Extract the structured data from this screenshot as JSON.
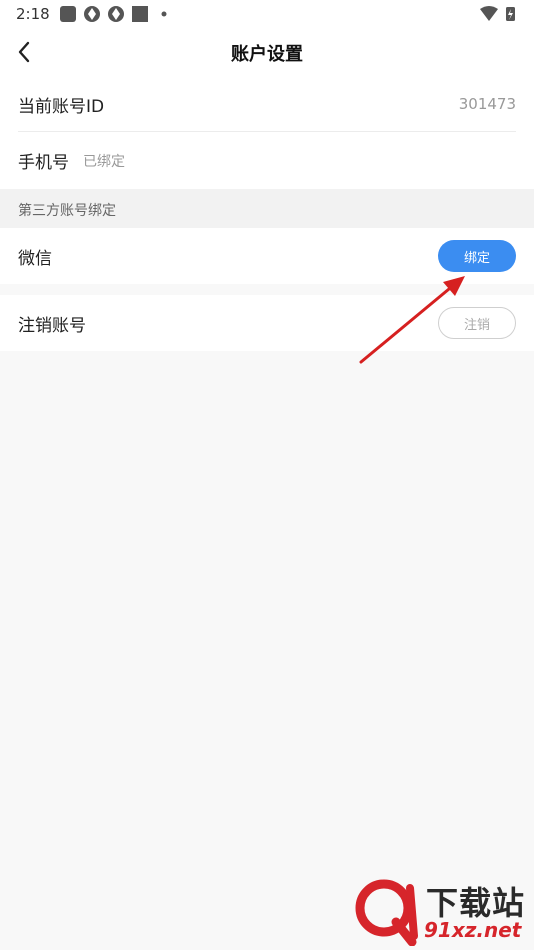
{
  "status_bar": {
    "time": "2:18"
  },
  "nav": {
    "title": "账户设置"
  },
  "account": {
    "id_label": "当前账号ID",
    "id_value": "301473",
    "phone_label": "手机号",
    "phone_status": "已绑定"
  },
  "third_party": {
    "section_title": "第三方账号绑定",
    "wechat_label": "微信",
    "bind_button": "绑定"
  },
  "deregister": {
    "label": "注销账号",
    "button": "注销"
  },
  "watermark": {
    "line1": "下载站",
    "line2": "91xz.net"
  },
  "colors": {
    "accent": "#3b8df1",
    "arrow": "#d62020",
    "watermark_red": "#d6252b"
  }
}
